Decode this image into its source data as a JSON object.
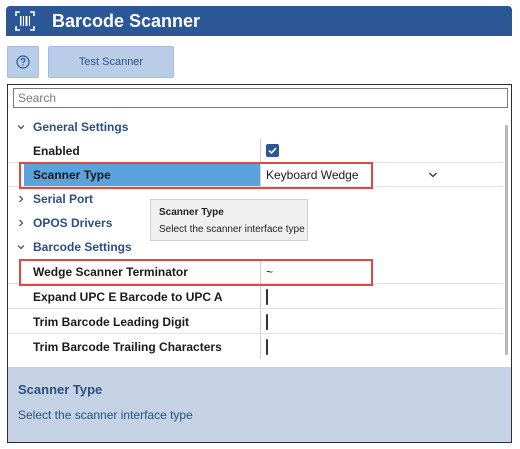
{
  "window": {
    "title": "Barcode Scanner",
    "icon": "barcode-icon",
    "accent_color": "#2b5797"
  },
  "toolbar": {
    "help_icon": "question-circle-icon",
    "test_label": "Test Scanner"
  },
  "search": {
    "placeholder": "Search"
  },
  "grid": {
    "categories": {
      "general": "General Settings",
      "serial": "Serial Port",
      "opos": "OPOS Drivers",
      "barcode": "Barcode Settings"
    },
    "properties": {
      "enabled": {
        "name": "Enabled",
        "checked": true
      },
      "scanner_type": {
        "name": "Scanner Type",
        "value": "Keyboard Wedge"
      },
      "terminator": {
        "name": "Wedge Scanner Terminator",
        "value": "~"
      },
      "expand_upce": {
        "name": "Expand UPC E Barcode to UPC A",
        "checked": false
      },
      "trim_leading": {
        "name": "Trim Barcode Leading Digit",
        "checked": false
      },
      "trim_trailing": {
        "name": "Trim Barcode Trailing Characters",
        "checked": false
      }
    }
  },
  "tooltip": {
    "title": "Scanner Type",
    "description": "Select the scanner interface type"
  },
  "description_panel": {
    "title": "Scanner Type",
    "text": "Select the scanner interface type"
  }
}
